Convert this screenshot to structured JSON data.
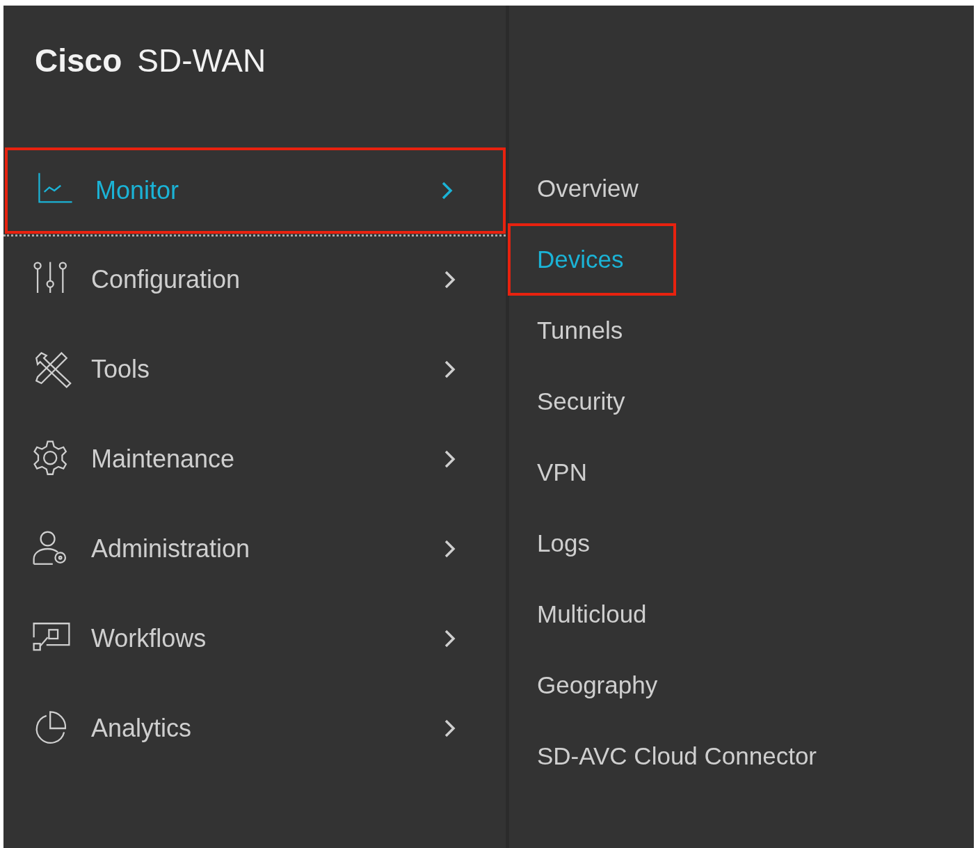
{
  "brand": {
    "name": "Cisco",
    "product": "SD-WAN"
  },
  "menu": [
    {
      "label": "Monitor",
      "selected": true,
      "highlighted": true
    },
    {
      "label": "Configuration",
      "selected": false,
      "highlighted": false
    },
    {
      "label": "Tools",
      "selected": false,
      "highlighted": false
    },
    {
      "label": "Maintenance",
      "selected": false,
      "highlighted": false
    },
    {
      "label": "Administration",
      "selected": false,
      "highlighted": false
    },
    {
      "label": "Workflows",
      "selected": false,
      "highlighted": false
    },
    {
      "label": "Analytics",
      "selected": false,
      "highlighted": false
    }
  ],
  "submenu": [
    {
      "label": "Overview",
      "selected": false,
      "highlighted": false
    },
    {
      "label": "Devices",
      "selected": true,
      "highlighted": true
    },
    {
      "label": "Tunnels",
      "selected": false,
      "highlighted": false
    },
    {
      "label": "Security",
      "selected": false,
      "highlighted": false
    },
    {
      "label": "VPN",
      "selected": false,
      "highlighted": false
    },
    {
      "label": "Logs",
      "selected": false,
      "highlighted": false
    },
    {
      "label": "Multicloud",
      "selected": false,
      "highlighted": false
    },
    {
      "label": "Geography",
      "selected": false,
      "highlighted": false
    },
    {
      "label": "SD-AVC Cloud Connector",
      "selected": false,
      "highlighted": false
    }
  ]
}
